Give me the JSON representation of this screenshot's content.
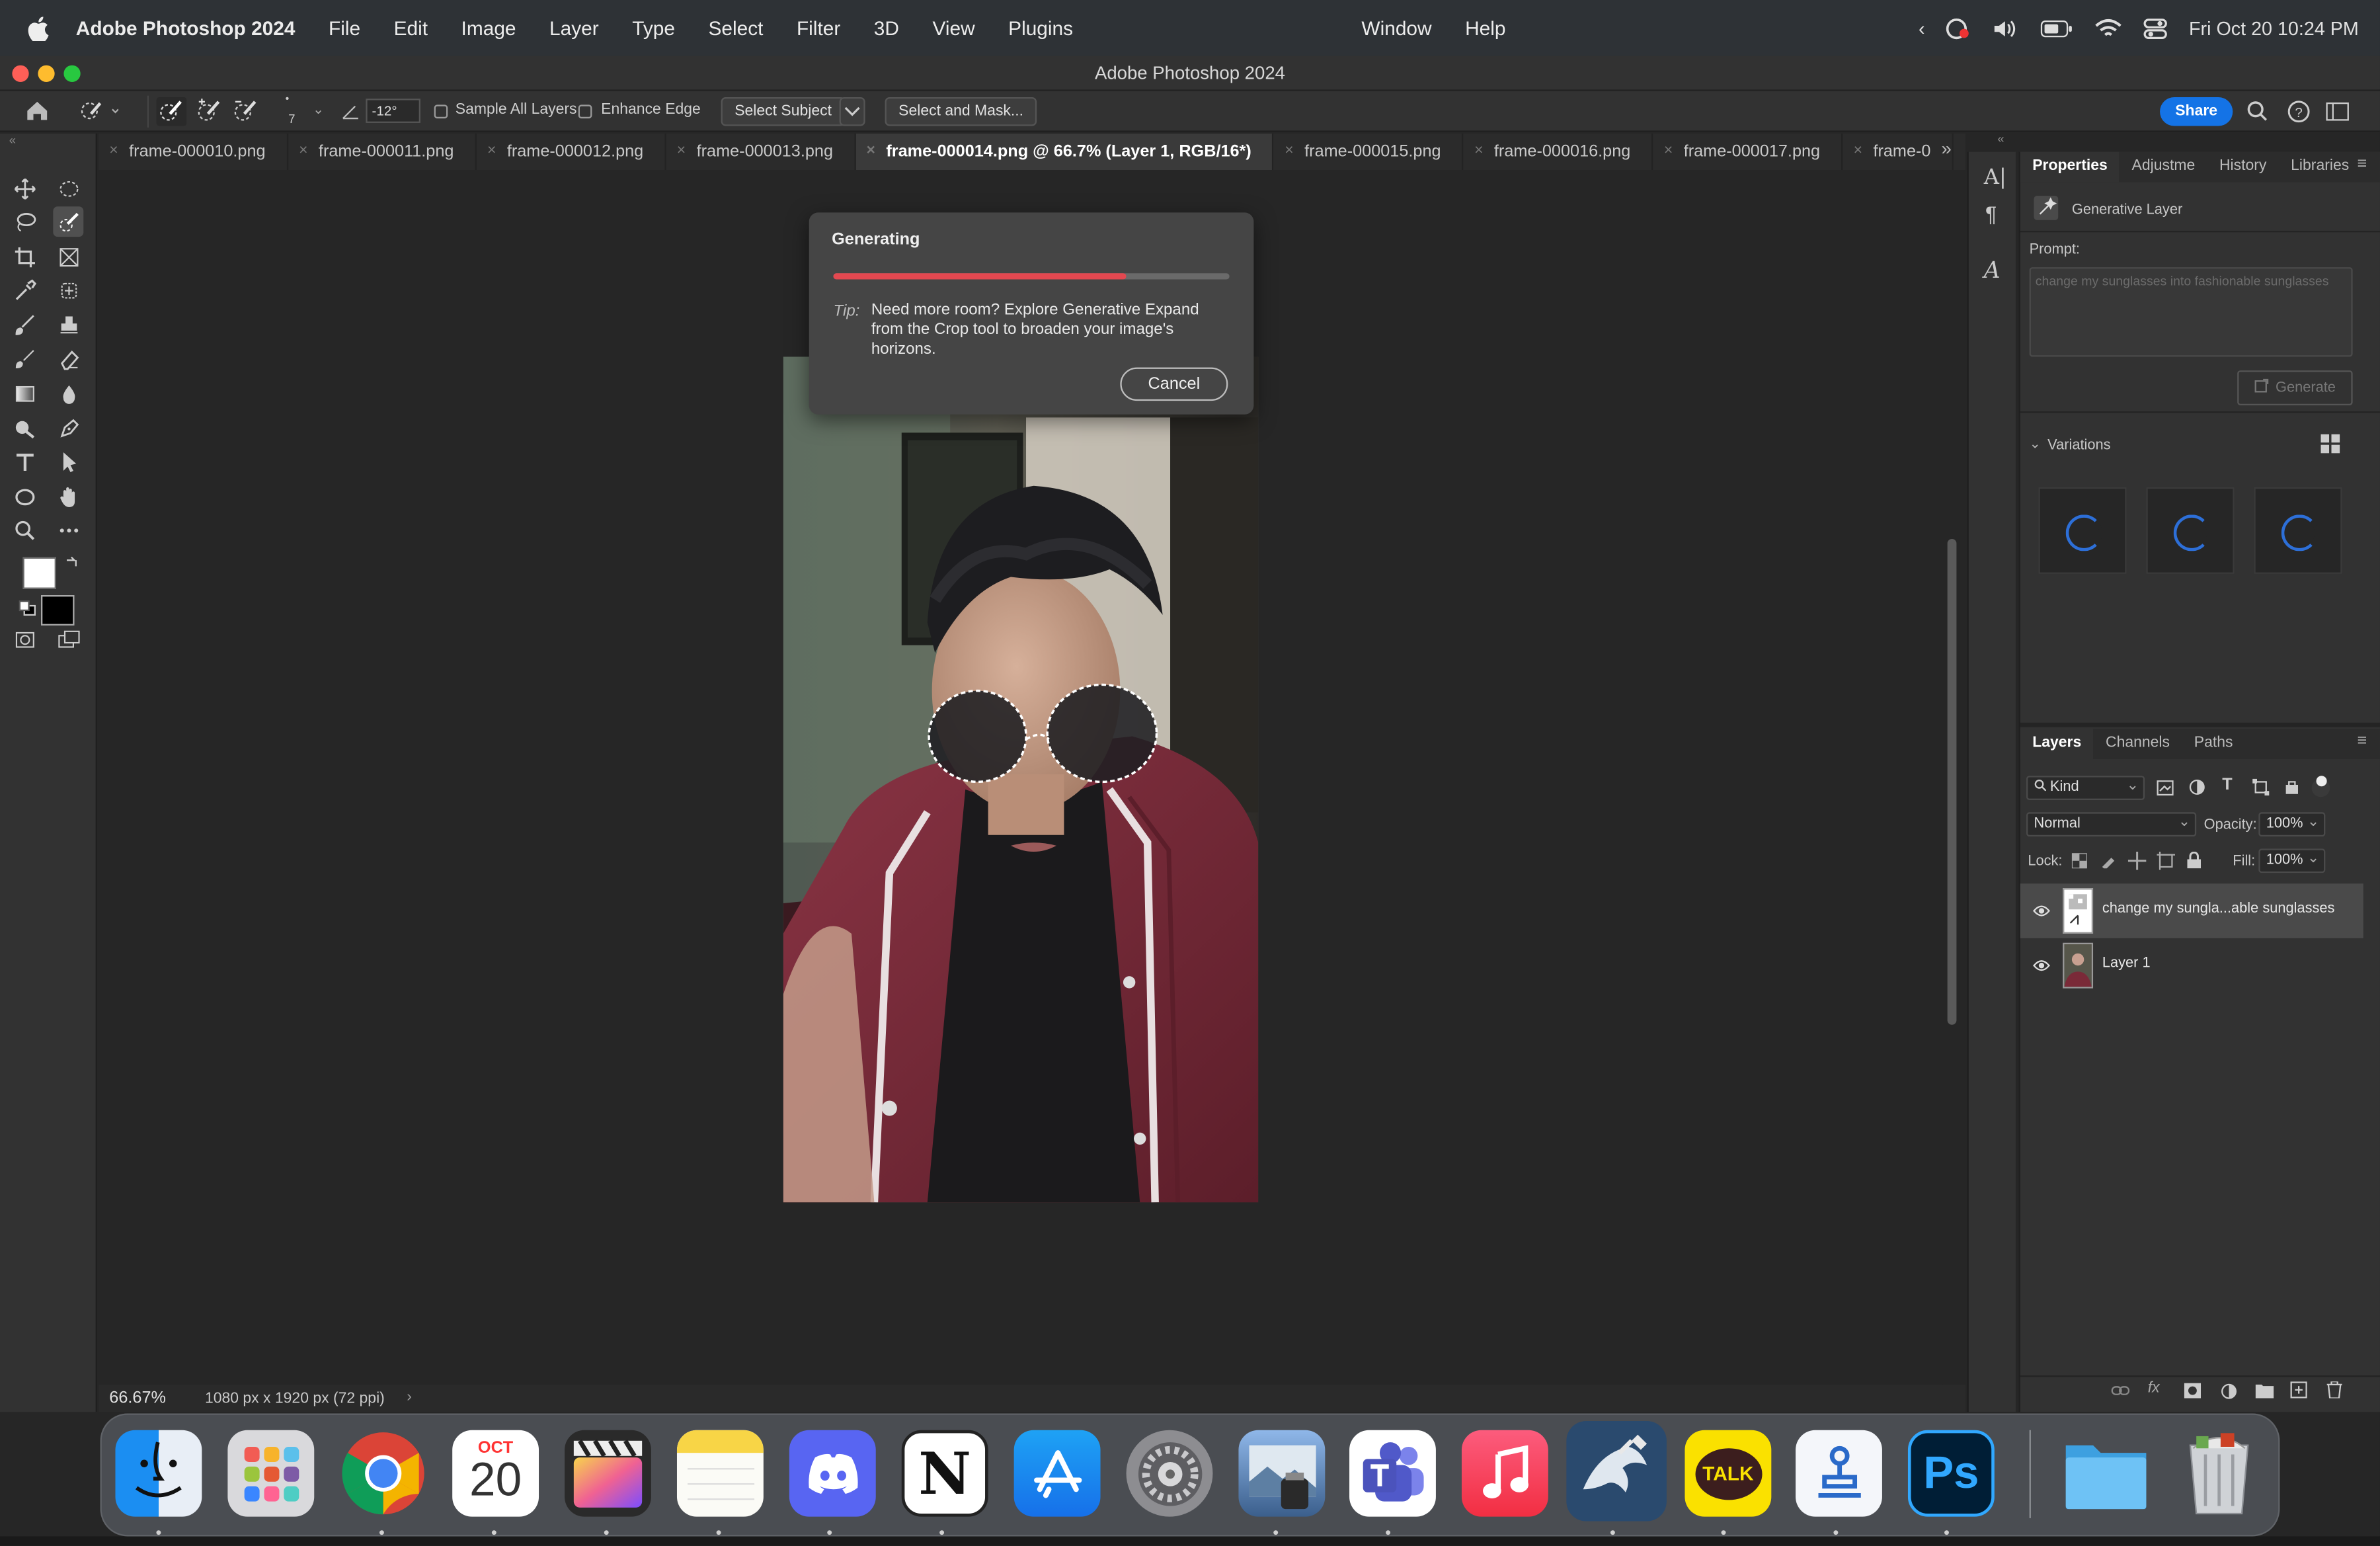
{
  "menubar": {
    "app_name": "Adobe Photoshop 2024",
    "items": [
      "File",
      "Edit",
      "Image",
      "Layer",
      "Type",
      "Select",
      "Filter",
      "3D",
      "View",
      "Plugins"
    ],
    "right_items": [
      "Window",
      "Help"
    ],
    "datetime": "Fri Oct 20  10:24 PM"
  },
  "window": {
    "title": "Adobe Photoshop 2024"
  },
  "options_bar": {
    "brush_size": "7",
    "angle": "-12°",
    "sample_all_layers": "Sample All Layers",
    "enhance_edge": "Enhance Edge",
    "select_subject": "Select Subject",
    "select_and_mask": "Select and Mask...",
    "share": "Share"
  },
  "tabs": [
    {
      "label": "frame-000010.png",
      "active": false
    },
    {
      "label": "frame-000011.png",
      "active": false
    },
    {
      "label": "frame-000012.png",
      "active": false
    },
    {
      "label": "frame-000013.png",
      "active": false
    },
    {
      "label": "frame-000014.png @ 66.7% (Layer 1, RGB/16*)",
      "active": true
    },
    {
      "label": "frame-000015.png",
      "active": false
    },
    {
      "label": "frame-000016.png",
      "active": false
    },
    {
      "label": "frame-000017.png",
      "active": false
    },
    {
      "label": "frame-0",
      "active": false
    }
  ],
  "dialog": {
    "title": "Generating",
    "progress": 0.74,
    "tip_label": "Tip:",
    "tip_text": "Need more room? Explore Generative Expand from the Crop tool to broaden your image's horizons.",
    "cancel": "Cancel"
  },
  "statusbar": {
    "zoom": "66.67%",
    "doc_info": "1080 px x 1920 px (72 ppi)"
  },
  "properties": {
    "tabs": [
      "Properties",
      "Adjustme",
      "History",
      "Libraries"
    ],
    "layer_type": "Generative Layer",
    "prompt_label": "Prompt:",
    "prompt_placeholder": "change my sunglasses into fashionable sunglasses",
    "generate": "Generate",
    "variations": "Variations"
  },
  "layers": {
    "tabs": [
      "Layers",
      "Channels",
      "Paths"
    ],
    "filter": "Kind",
    "blend_mode": "Normal",
    "opacity_label": "Opacity:",
    "opacity": "100%",
    "lock_label": "Lock:",
    "fill_label": "Fill:",
    "fill": "100%",
    "rows": [
      {
        "name": "change my sungla...able sunglasses"
      },
      {
        "name": "Layer 1"
      }
    ]
  },
  "dock": {
    "calendar_month": "OCT",
    "calendar_day": "20",
    "kakao_label": "TALK",
    "ps_label": "Ps",
    "notion_label": "N"
  },
  "colors": {
    "accent": "#1473e6",
    "progress": "#e34850",
    "spinner": "#2d6fd8"
  }
}
